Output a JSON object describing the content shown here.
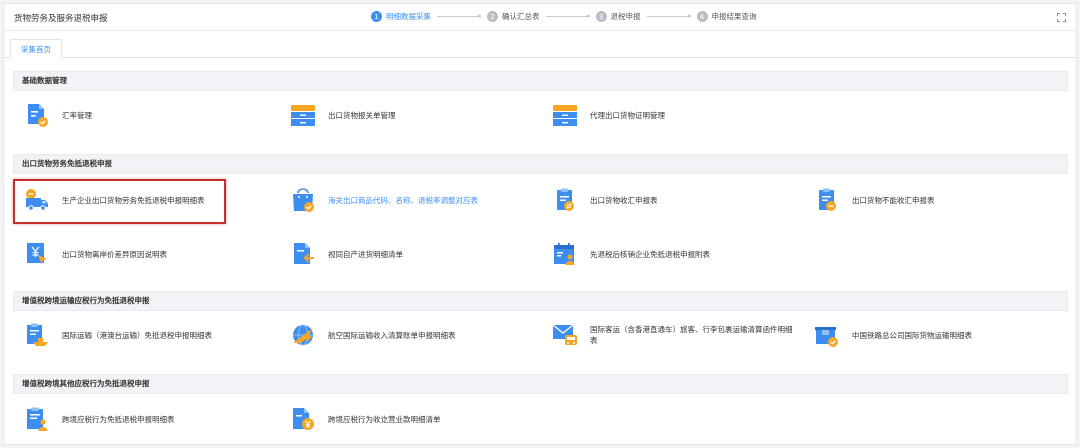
{
  "header": {
    "title": "货物劳务及服务退税申报",
    "steps": [
      {
        "num": "1",
        "label": "明细数据采集",
        "active": true
      },
      {
        "num": "2",
        "label": "确认汇总表"
      },
      {
        "num": "3",
        "label": "退税申报"
      },
      {
        "num": "4",
        "label": "申报结果查询"
      }
    ],
    "fullscreen_icon": "fullscreen-icon"
  },
  "tab": {
    "label": "采集首页"
  },
  "sections": [
    {
      "title": "基础数据管理",
      "items": [
        {
          "label": "汇率管理",
          "icon": "document-check-icon"
        },
        {
          "label": "出口货物报关单管理",
          "icon": "cabinet-drawer-icon"
        },
        {
          "label": "代理出口货物证明管理",
          "icon": "cabinet-drawer-icon"
        }
      ]
    },
    {
      "title": "出口货物劳务免抵退税申报",
      "items": [
        {
          "label": "生产企业出口货物劳务免抵退税申报明细表",
          "icon": "delivery-truck-icon"
        },
        {
          "label": "海关出口商品代码、名称、退税率调整对应表",
          "icon": "shopping-bag-check-icon"
        },
        {
          "label": "出口货物收汇申报表",
          "icon": "clipboard-exchange-icon"
        },
        {
          "label": "出口货物不能收汇申报表",
          "icon": "clipboard-minus-icon"
        },
        {
          "label": "出口货物离岸价差异原因说明表",
          "icon": "yuan-cursor-icon"
        },
        {
          "label": "视同自产进货明细清单",
          "icon": "document-import-icon"
        },
        {
          "label": "先退税后核销企业免抵退税申报附表",
          "icon": "calendar-person-icon"
        }
      ]
    },
    {
      "title": "增值税跨境运输应税行为免抵退税申报",
      "items": [
        {
          "label": "国际运输（港澳台运输）免抵退税申报明细表",
          "icon": "clipboard-ship-icon"
        },
        {
          "label": "航空国际运输收入清算账单申报明细表",
          "icon": "airplane-globe-icon"
        },
        {
          "label": "国际客运（含香港直通车）旅客、行李包裹运输清算函件明细表",
          "icon": "mail-bus-icon"
        },
        {
          "label": "中国铁路总公司国际货物运输明细表",
          "icon": "box-check-icon"
        }
      ]
    },
    {
      "title": "增值税跨境其他应税行为免抵退税申报",
      "items": [
        {
          "label": "跨境应税行为免抵退税申报明细表",
          "icon": "clipboard-person-icon"
        },
        {
          "label": "跨境应税行为收讫营业款明细清单",
          "icon": "document-yuan-icon"
        }
      ]
    }
  ],
  "colors": {
    "accent": "#3d8ef0",
    "icon_blue": "#3d8ef0",
    "icon_orange": "#f5a623",
    "highlight": "#c82d2d"
  }
}
